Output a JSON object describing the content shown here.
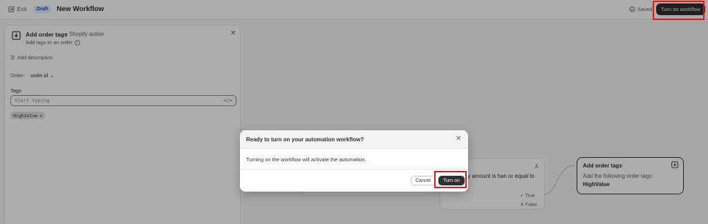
{
  "header": {
    "exit_label": "Exit",
    "status_badge": "Draft",
    "title": "New Workflow",
    "saved_label": "Saved",
    "turn_on_workflow_label": "Turn on workflow"
  },
  "panel": {
    "title": "Add order tags",
    "subtype": "• Shopify action",
    "description": "Add tags to an order",
    "add_description_label": "Add description",
    "order_label": "Order:",
    "order_value": "order.id",
    "tags_label": "Tags",
    "tags_placeholder": "Start typing",
    "tag_chip": "HighValue",
    "icons": [
      "download-box-icon",
      "info-icon",
      "close-icon",
      "description-icon",
      "chevron-down-icon",
      "code-icon"
    ]
  },
  "canvas": {
    "condition_text": "ent money amount is han or equal to 1000",
    "true_label": "True",
    "false_label": "False",
    "tags_node": {
      "title": "Add order tags",
      "description": "Add the following order tags:",
      "value": "HighValue"
    }
  },
  "modal": {
    "title": "Ready to turn on your automation workflow?",
    "body": "Turning on the workflow will activate the automation.",
    "cancel_label": "Cancel",
    "turn_on_label": "Turn on"
  },
  "colors": {
    "primary_button": "#303030",
    "badge_bg": "#e0ecff",
    "badge_text": "#1f4eb8",
    "highlight": "#ee1111"
  }
}
